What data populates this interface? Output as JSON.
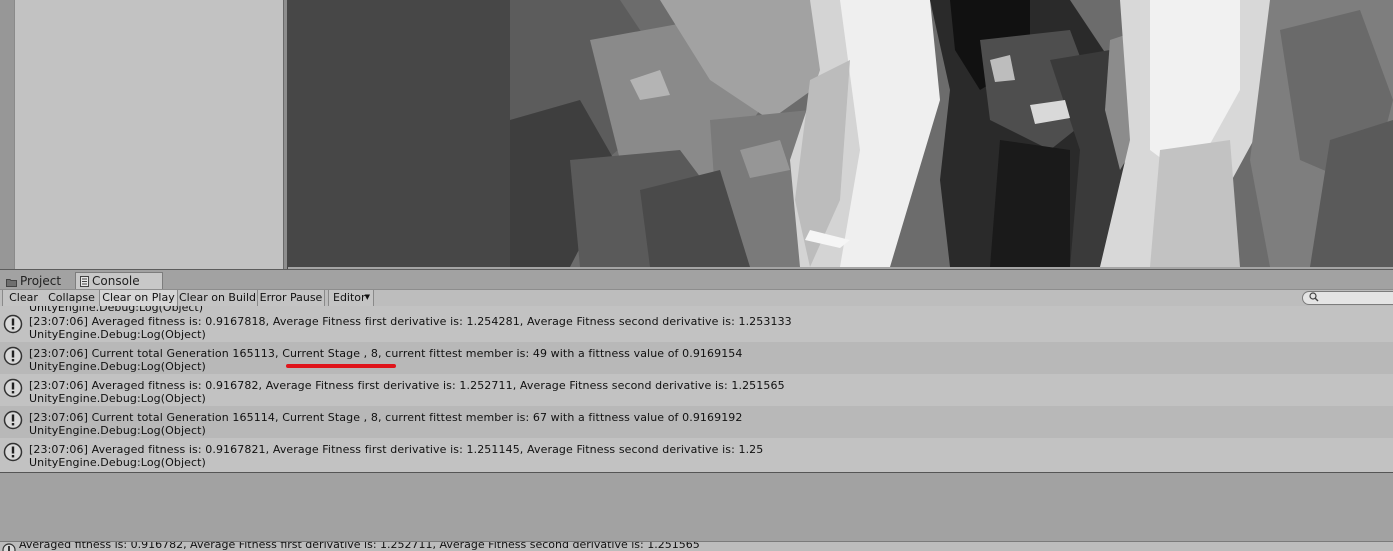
{
  "tabs": [
    {
      "label": "Project",
      "icon": "folder-icon"
    },
    {
      "label": "Console",
      "icon": "console-icon"
    }
  ],
  "toolbar": {
    "clear": "Clear",
    "collapse": "Collapse",
    "clear_on_play": "Clear on Play",
    "clear_on_build": "Clear on Build",
    "error_pause": "Error Pause",
    "editor": "Editor",
    "search_value": ""
  },
  "log": {
    "partial_top": "UnityEngine.Debug:Log(Object)",
    "entries": [
      {
        "line1": "[23:07:06] Averaged fitness is: 0.9167818, Average Fitness first derivative is: 1.254281, Average Fitness second derivative is: 1.253133",
        "line2": "UnityEngine.Debug:Log(Object)"
      },
      {
        "line1": "[23:07:06] Current total Generation 165113, Current Stage , 8, current fittest member is: 49 with a fittness value of 0.9169154",
        "line2": "UnityEngine.Debug:Log(Object)"
      },
      {
        "line1": "[23:07:06] Averaged fitness is: 0.916782, Average Fitness first derivative is: 1.252711, Average Fitness second derivative is: 1.251565",
        "line2": "UnityEngine.Debug:Log(Object)"
      },
      {
        "line1": "[23:07:06] Current total Generation 165114, Current Stage , 8, current fittest member is: 67 with a fittness value of 0.9169192",
        "line2": "UnityEngine.Debug:Log(Object)"
      },
      {
        "line1": "[23:07:06] Averaged fitness is: 0.9167821, Average Fitness first derivative is: 1.251145, Average Fitness second derivative is: 1.25",
        "line2": "UnityEngine.Debug:Log(Object)"
      }
    ]
  },
  "status_bar": {
    "text": "Averaged fitness is: 0.916782, Average Fitness first derivative is: 1.252711, Average Fitness second derivative is: 1.251565"
  },
  "colors": {
    "annotation_red": "#e0141b",
    "panel_gray": "#c2c2c2",
    "scene_dark": "#474747"
  }
}
